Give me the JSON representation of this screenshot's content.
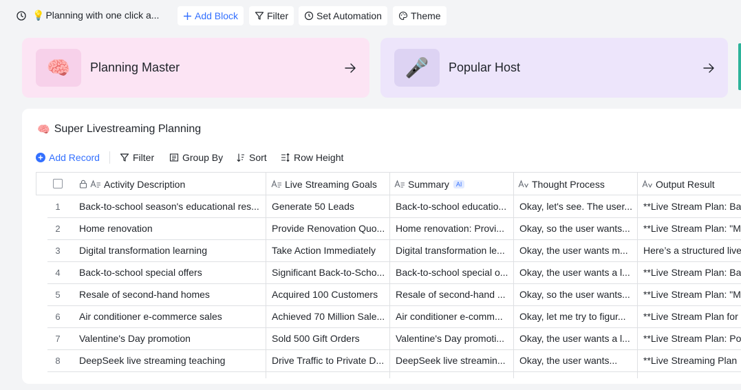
{
  "topbar": {
    "plan_title": "Planning with one click a...",
    "add_block": "Add Block",
    "filter": "Filter",
    "set_automation": "Set Automation",
    "theme": "Theme"
  },
  "cards": [
    {
      "emoji": "🧠",
      "label": "Planning Master"
    },
    {
      "emoji": "🎤",
      "label": "Popular Host"
    }
  ],
  "panel": {
    "title_emoji": "🧠",
    "title": "Super Livestreaming Planning",
    "toolbar": {
      "add_record": "Add Record",
      "filter": "Filter",
      "group_by": "Group By",
      "sort": "Sort",
      "row_height": "Row Height"
    }
  },
  "table": {
    "columns": [
      "Activity Description",
      "Live Streaming Goals",
      "Summary",
      "Thought Process",
      "Output Result"
    ],
    "ai_badge": "AI",
    "rows": [
      {
        "n": "1",
        "c1": "Back-to-school season's educational res...",
        "c2": "Generate 50 Leads",
        "c3": "Back-to-school educatio...",
        "c4": "Okay, let's see. The user...",
        "c5": "**Live Stream Plan: Ba"
      },
      {
        "n": "2",
        "c1": "Home renovation",
        "c2": "Provide Renovation Quo...",
        "c3": "Home renovation: Provi...",
        "c4": "Okay, so the user wants...",
        "c5": "**Live Stream Plan: \"M"
      },
      {
        "n": "3",
        "c1": "Digital transformation learning",
        "c2": "Take Action Immediately",
        "c3": "Digital transformation le...",
        "c4": "Okay, the user wants m...",
        "c5": "Here’s a structured live"
      },
      {
        "n": "4",
        "c1": "Back-to-school special offers",
        "c2": "Significant Back-to-Scho...",
        "c3": "Back-to-school special o...",
        "c4": "Okay, the user wants a l...",
        "c5": "**Live Stream Plan: Ba"
      },
      {
        "n": "5",
        "c1": "Resale of second-hand homes",
        "c2": "Acquired 100 Customers",
        "c3": "Resale of second-hand ...",
        "c4": "Okay, so the user wants...",
        "c5": "**Live Stream Plan: \"M"
      },
      {
        "n": "6",
        "c1": "Air conditioner e-commerce sales",
        "c2": "Achieved 70 Million Sale...",
        "c3": "Air conditioner e-comm...",
        "c4": "Okay, let me try to figur...",
        "c5": "**Live Stream Plan for"
      },
      {
        "n": "7",
        "c1": "Valentine's Day promotion",
        "c2": "Sold 500 Gift Orders",
        "c3": "Valentine's Day promoti...",
        "c4": "Okay, the user wants a l...",
        "c5": "**Live Stream Plan: Po"
      },
      {
        "n": "8",
        "c1": "DeepSeek live streaming teaching",
        "c2": "Drive Traffic to Private D...",
        "c3": "DeepSeek live streamin...",
        "c4": "Okay, the user wants...",
        "c5": "**Live Streaming Plan"
      }
    ]
  },
  "colors": {
    "accent": "#3370ff",
    "card_pink": "#fce4f4",
    "card_purple": "#ede5fb",
    "edge_teal": "#2db39a"
  },
  "icons": [
    "history-icon",
    "bulb-icon",
    "plus-icon",
    "filter-icon",
    "automation-icon",
    "palette-icon",
    "brain-icon",
    "microphone-icon",
    "arrow-right-icon",
    "plus-circle-icon",
    "group-icon",
    "sort-icon",
    "row-height-icon",
    "lock-icon",
    "text-field-icon",
    "ai-text-field-icon"
  ]
}
